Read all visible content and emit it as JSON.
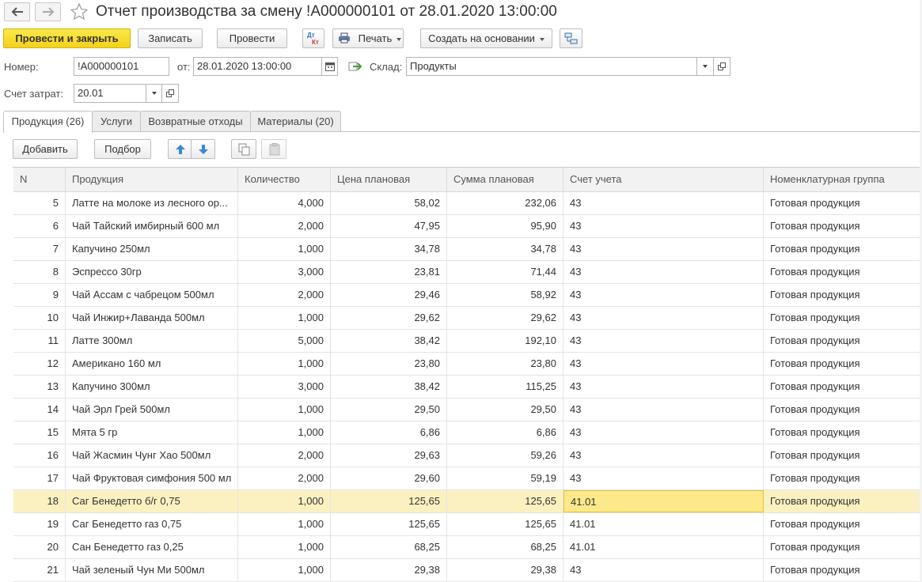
{
  "header": {
    "title": "Отчет производства за смену !А000000101 от 28.01.2020 13:00:00"
  },
  "toolbar": {
    "post_close": "Провести и закрыть",
    "save": "Записать",
    "post": "Провести",
    "dtkt_top": "Дт",
    "dtkt_bottom": "Кт",
    "print": "Печать",
    "create_based": "Создать на основании"
  },
  "form": {
    "number_label": "Номер:",
    "number_value": "!А000000101",
    "date_label": "от:",
    "date_value": "28.01.2020 13:00:00",
    "warehouse_label": "Склад:",
    "warehouse_value": "Продукты",
    "cost_account_label": "Счет затрат:",
    "cost_account_value": "20.01"
  },
  "tabs": [
    {
      "label": "Продукция (26)",
      "active": true
    },
    {
      "label": "Услуги",
      "active": false
    },
    {
      "label": "Возвратные отходы",
      "active": false
    },
    {
      "label": "Материалы (20)",
      "active": false
    }
  ],
  "table_toolbar": {
    "add": "Добавить",
    "pick": "Подбор"
  },
  "table": {
    "columns": [
      "N",
      "Продукция",
      "Количество",
      "Цена плановая",
      "Сумма плановая",
      "Счет учета",
      "Номенклатурная группа"
    ],
    "rows": [
      [
        "5",
        "Латте на молоке из лесного ор...",
        "4,000",
        "58,02",
        "232,06",
        "43",
        "Готовая продукция"
      ],
      [
        "6",
        "Чай Тайский имбирный 600 мл",
        "2,000",
        "47,95",
        "95,90",
        "43",
        "Готовая продукция"
      ],
      [
        "7",
        "Капучино 250мл",
        "1,000",
        "34,78",
        "34,78",
        "43",
        "Готовая продукция"
      ],
      [
        "8",
        "Эспрессо 30гр",
        "3,000",
        "23,81",
        "71,44",
        "43",
        "Готовая продукция"
      ],
      [
        "9",
        "Чай Ассам с чабрецом 500мл",
        "2,000",
        "29,46",
        "58,92",
        "43",
        "Готовая продукция"
      ],
      [
        "10",
        "Чай Инжир+Лаванда 500мл",
        "1,000",
        "29,62",
        "29,62",
        "43",
        "Готовая продукция"
      ],
      [
        "11",
        "Латте 300мл",
        "5,000",
        "38,42",
        "192,10",
        "43",
        "Готовая продукция"
      ],
      [
        "12",
        "Американо 160 мл",
        "1,000",
        "23,80",
        "23,80",
        "43",
        "Готовая продукция"
      ],
      [
        "13",
        "Капучино 300мл",
        "3,000",
        "38,42",
        "115,25",
        "43",
        "Готовая продукция"
      ],
      [
        "14",
        "Чай Эрл Грей 500мл",
        "1,000",
        "29,50",
        "29,50",
        "43",
        "Готовая продукция"
      ],
      [
        "15",
        "Мята 5 гр",
        "1,000",
        "6,86",
        "6,86",
        "43",
        "Готовая продукция"
      ],
      [
        "16",
        "Чай Жасмин Чунг Хао 500мл",
        "2,000",
        "29,63",
        "59,26",
        "43",
        "Готовая продукция"
      ],
      [
        "17",
        "Чай Фруктовая симфония 500 мл",
        "2,000",
        "29,60",
        "59,19",
        "43",
        "Готовая продукция"
      ],
      [
        "18",
        "Саг Бенедетто б/г 0,75",
        "1,000",
        "125,65",
        "125,65",
        "41.01",
        "Готовая продукция"
      ],
      [
        "19",
        "Саг Бенедетто газ 0,75",
        "1,000",
        "125,65",
        "125,65",
        "41.01",
        "Готовая продукция"
      ],
      [
        "20",
        "Сан Бенедетто газ 0,25",
        "1,000",
        "68,25",
        "68,25",
        "41.01",
        "Готовая продукция"
      ],
      [
        "21",
        "Чай зеленый Чун Ми 500мл",
        "1,000",
        "29,38",
        "29,38",
        "43",
        "Готовая продукция"
      ]
    ],
    "selected_row": 13
  }
}
